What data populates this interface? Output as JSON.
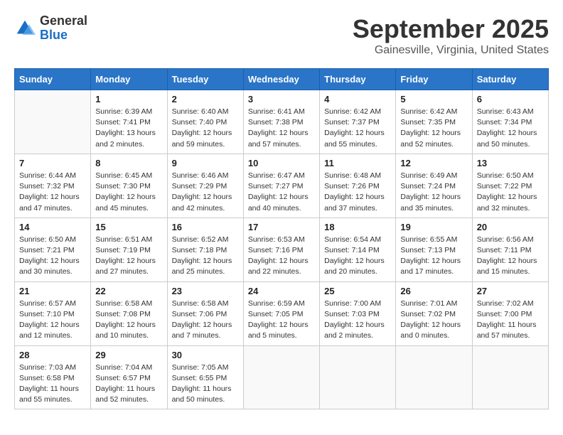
{
  "logo": {
    "general": "General",
    "blue": "Blue"
  },
  "title": "September 2025",
  "subtitle": "Gainesville, Virginia, United States",
  "days_of_week": [
    "Sunday",
    "Monday",
    "Tuesday",
    "Wednesday",
    "Thursday",
    "Friday",
    "Saturday"
  ],
  "weeks": [
    [
      {
        "day": "",
        "detail": ""
      },
      {
        "day": "1",
        "detail": "Sunrise: 6:39 AM\nSunset: 7:41 PM\nDaylight: 13 hours\nand 2 minutes."
      },
      {
        "day": "2",
        "detail": "Sunrise: 6:40 AM\nSunset: 7:40 PM\nDaylight: 12 hours\nand 59 minutes."
      },
      {
        "day": "3",
        "detail": "Sunrise: 6:41 AM\nSunset: 7:38 PM\nDaylight: 12 hours\nand 57 minutes."
      },
      {
        "day": "4",
        "detail": "Sunrise: 6:42 AM\nSunset: 7:37 PM\nDaylight: 12 hours\nand 55 minutes."
      },
      {
        "day": "5",
        "detail": "Sunrise: 6:42 AM\nSunset: 7:35 PM\nDaylight: 12 hours\nand 52 minutes."
      },
      {
        "day": "6",
        "detail": "Sunrise: 6:43 AM\nSunset: 7:34 PM\nDaylight: 12 hours\nand 50 minutes."
      }
    ],
    [
      {
        "day": "7",
        "detail": "Sunrise: 6:44 AM\nSunset: 7:32 PM\nDaylight: 12 hours\nand 47 minutes."
      },
      {
        "day": "8",
        "detail": "Sunrise: 6:45 AM\nSunset: 7:30 PM\nDaylight: 12 hours\nand 45 minutes."
      },
      {
        "day": "9",
        "detail": "Sunrise: 6:46 AM\nSunset: 7:29 PM\nDaylight: 12 hours\nand 42 minutes."
      },
      {
        "day": "10",
        "detail": "Sunrise: 6:47 AM\nSunset: 7:27 PM\nDaylight: 12 hours\nand 40 minutes."
      },
      {
        "day": "11",
        "detail": "Sunrise: 6:48 AM\nSunset: 7:26 PM\nDaylight: 12 hours\nand 37 minutes."
      },
      {
        "day": "12",
        "detail": "Sunrise: 6:49 AM\nSunset: 7:24 PM\nDaylight: 12 hours\nand 35 minutes."
      },
      {
        "day": "13",
        "detail": "Sunrise: 6:50 AM\nSunset: 7:22 PM\nDaylight: 12 hours\nand 32 minutes."
      }
    ],
    [
      {
        "day": "14",
        "detail": "Sunrise: 6:50 AM\nSunset: 7:21 PM\nDaylight: 12 hours\nand 30 minutes."
      },
      {
        "day": "15",
        "detail": "Sunrise: 6:51 AM\nSunset: 7:19 PM\nDaylight: 12 hours\nand 27 minutes."
      },
      {
        "day": "16",
        "detail": "Sunrise: 6:52 AM\nSunset: 7:18 PM\nDaylight: 12 hours\nand 25 minutes."
      },
      {
        "day": "17",
        "detail": "Sunrise: 6:53 AM\nSunset: 7:16 PM\nDaylight: 12 hours\nand 22 minutes."
      },
      {
        "day": "18",
        "detail": "Sunrise: 6:54 AM\nSunset: 7:14 PM\nDaylight: 12 hours\nand 20 minutes."
      },
      {
        "day": "19",
        "detail": "Sunrise: 6:55 AM\nSunset: 7:13 PM\nDaylight: 12 hours\nand 17 minutes."
      },
      {
        "day": "20",
        "detail": "Sunrise: 6:56 AM\nSunset: 7:11 PM\nDaylight: 12 hours\nand 15 minutes."
      }
    ],
    [
      {
        "day": "21",
        "detail": "Sunrise: 6:57 AM\nSunset: 7:10 PM\nDaylight: 12 hours\nand 12 minutes."
      },
      {
        "day": "22",
        "detail": "Sunrise: 6:58 AM\nSunset: 7:08 PM\nDaylight: 12 hours\nand 10 minutes."
      },
      {
        "day": "23",
        "detail": "Sunrise: 6:58 AM\nSunset: 7:06 PM\nDaylight: 12 hours\nand 7 minutes."
      },
      {
        "day": "24",
        "detail": "Sunrise: 6:59 AM\nSunset: 7:05 PM\nDaylight: 12 hours\nand 5 minutes."
      },
      {
        "day": "25",
        "detail": "Sunrise: 7:00 AM\nSunset: 7:03 PM\nDaylight: 12 hours\nand 2 minutes."
      },
      {
        "day": "26",
        "detail": "Sunrise: 7:01 AM\nSunset: 7:02 PM\nDaylight: 12 hours\nand 0 minutes."
      },
      {
        "day": "27",
        "detail": "Sunrise: 7:02 AM\nSunset: 7:00 PM\nDaylight: 11 hours\nand 57 minutes."
      }
    ],
    [
      {
        "day": "28",
        "detail": "Sunrise: 7:03 AM\nSunset: 6:58 PM\nDaylight: 11 hours\nand 55 minutes."
      },
      {
        "day": "29",
        "detail": "Sunrise: 7:04 AM\nSunset: 6:57 PM\nDaylight: 11 hours\nand 52 minutes."
      },
      {
        "day": "30",
        "detail": "Sunrise: 7:05 AM\nSunset: 6:55 PM\nDaylight: 11 hours\nand 50 minutes."
      },
      {
        "day": "",
        "detail": ""
      },
      {
        "day": "",
        "detail": ""
      },
      {
        "day": "",
        "detail": ""
      },
      {
        "day": "",
        "detail": ""
      }
    ]
  ]
}
